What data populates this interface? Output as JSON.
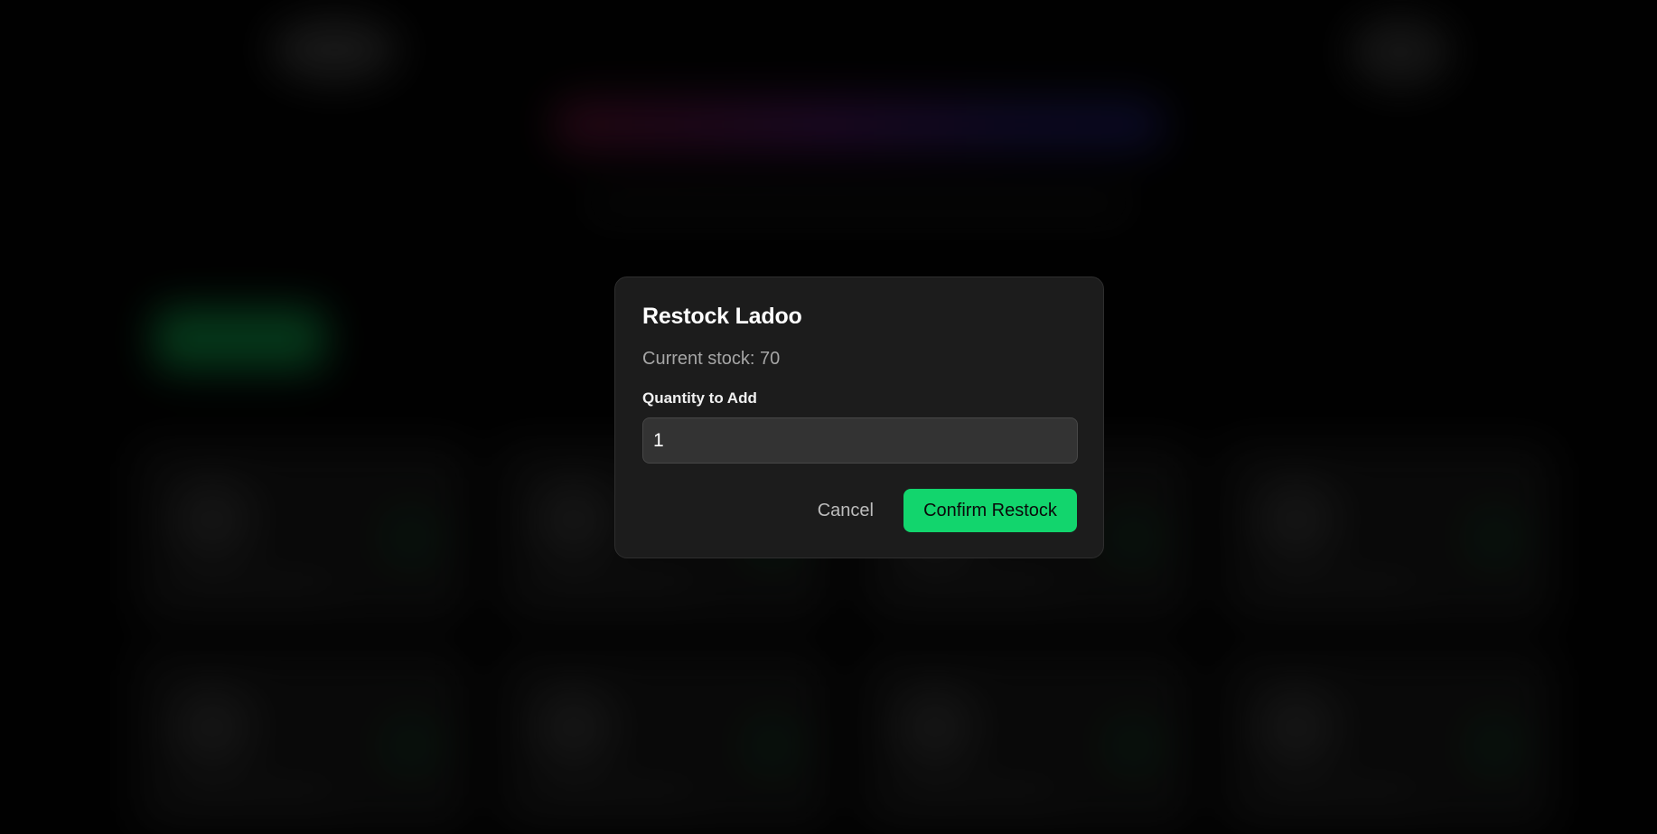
{
  "modal": {
    "title": "Restock Ladoo",
    "current_stock": "Current stock: 70",
    "quantity_label": "Quantity to Add",
    "quantity_value": "1",
    "cancel_label": "Cancel",
    "confirm_label": "Confirm Restock"
  },
  "colors": {
    "accent": "#12d56d",
    "modal_bg": "#1c1c1c",
    "input_bg": "#333333"
  }
}
